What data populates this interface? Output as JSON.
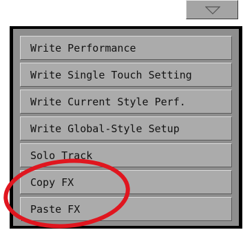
{
  "menu": {
    "items": [
      {
        "label": "Write Performance"
      },
      {
        "label": "Write Single Touch Setting"
      },
      {
        "label": "Write Current Style Perf."
      },
      {
        "label": "Write Global-Style Setup"
      },
      {
        "label": "Solo Track"
      },
      {
        "label": "Copy FX"
      },
      {
        "label": "Paste FX"
      }
    ]
  },
  "dropdown": {
    "icon": "triangle-down-icon"
  },
  "colors": {
    "panel_bg": "#8e8e8e",
    "item_bg": "#ababab",
    "highlight": "#e0161f"
  }
}
